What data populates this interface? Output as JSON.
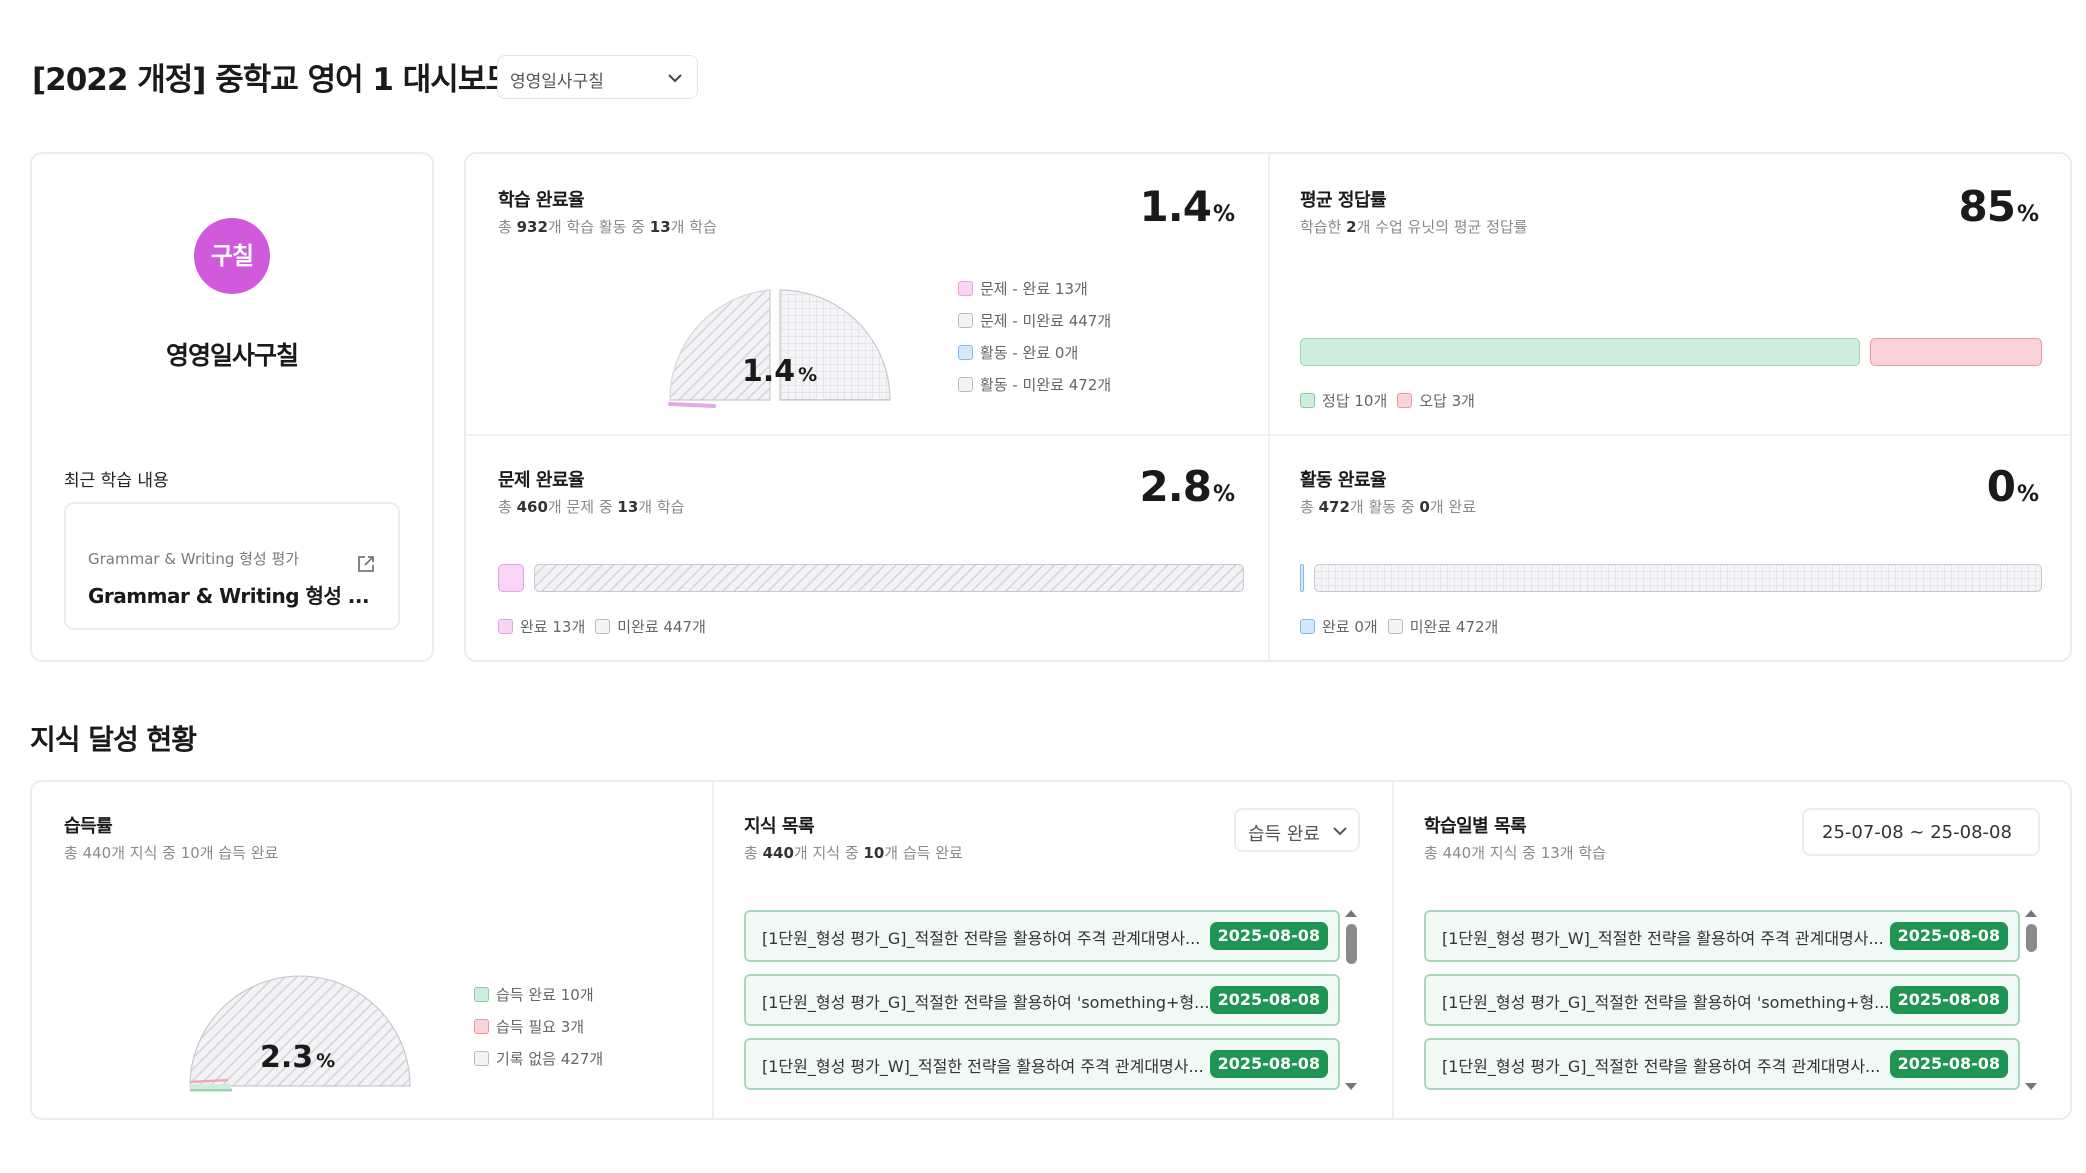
{
  "header": {
    "title": "[2022 개정] 중학교 영어 1 대시보드",
    "class_select": "영영일사구칠"
  },
  "profile": {
    "avatar_text": "구칠",
    "name": "영영일사구칠",
    "recent_title": "최근 학습 내용",
    "recent_sub": "Grammar & Writing 형성 평가",
    "recent_main": "Grammar & Writing 형성 ..."
  },
  "learning_completion": {
    "title": "학습 완료율",
    "sub_pre": "총 ",
    "sub_num1": "932",
    "sub_mid": "개 학습 활동 중 ",
    "sub_num2": "13",
    "sub_post": "개 학습",
    "value": "1.4",
    "unit": "%",
    "gauge_label": "1.4",
    "fraction": 0.014,
    "legend": [
      "문제 - 완료 13개",
      "문제 - 미완료 447개",
      "활동 - 완료 0개",
      "활동 - 미완료 472개"
    ]
  },
  "avg_accuracy": {
    "title": "평균 정답률",
    "sub_pre": "학습한 ",
    "sub_num": "2",
    "sub_post": "개 수업 유닛의 평균 정답률",
    "value": "85",
    "unit": "%",
    "correct": 10,
    "wrong": 3,
    "legend": [
      "정답 10개",
      "오답 3개"
    ]
  },
  "problem_completion": {
    "title": "문제 완료율",
    "sub_pre": "총 ",
    "sub_num1": "460",
    "sub_mid": "개 문제 중 ",
    "sub_num2": "13",
    "sub_post": "개 학습",
    "value": "2.8",
    "unit": "%",
    "legend": [
      "완료 13개",
      "미완료 447개"
    ]
  },
  "activity_completion": {
    "title": "활동 완료율",
    "sub_pre": "총 ",
    "sub_num1": "472",
    "sub_mid": "개 활동 중 ",
    "sub_num2": "0",
    "sub_post": "개 완료",
    "value": "0",
    "unit": "%",
    "legend": [
      "완료 0개",
      "미완료 472개"
    ]
  },
  "knowledge": {
    "section_title": "지식 달성 현황",
    "acquisition": {
      "title": "습득률",
      "sub": "총 440개 지식 중 10개 습득 완료",
      "gauge_label": "2.3",
      "unit": "%",
      "legend": [
        "습득 완료 10개",
        "습득 필요 3개",
        "기록 없음 427개"
      ]
    },
    "list": {
      "title": "지식 목록",
      "sub_pre": "총 ",
      "sub_num1": "440",
      "sub_mid": "개 지식 중 ",
      "sub_num2": "10",
      "sub_post": "개 습득 완료",
      "filter": "습득 완료",
      "items": [
        {
          "text": "[1단원_형성 평가_G]_적절한 전략을 활용하여 주격 관계대명사...",
          "date": "2025-08-08"
        },
        {
          "text": "[1단원_형성 평가_G]_적절한 전략을 활용하여 'something+형...",
          "date": "2025-08-08"
        },
        {
          "text": "[1단원_형성 평가_W]_적절한 전략을 활용하여 주격 관계대명사...",
          "date": "2025-08-08"
        }
      ]
    },
    "daily": {
      "title": "학습일별 목록",
      "sub": "총 440개 지식 중 13개 학습",
      "date_range": "25-07-08 ~ 25-08-08",
      "items": [
        {
          "text": "[1단원_형성 평가_W]_적절한 전략을 활용하여 주격 관계대명사...",
          "date": "2025-08-08"
        },
        {
          "text": "[1단원_형성 평가_G]_적절한 전략을 활용하여 'something+형...",
          "date": "2025-08-08"
        },
        {
          "text": "[1단원_형성 평가_G]_적절한 전략을 활용하여 주격 관계대명사...",
          "date": "2025-08-08"
        }
      ]
    }
  }
}
